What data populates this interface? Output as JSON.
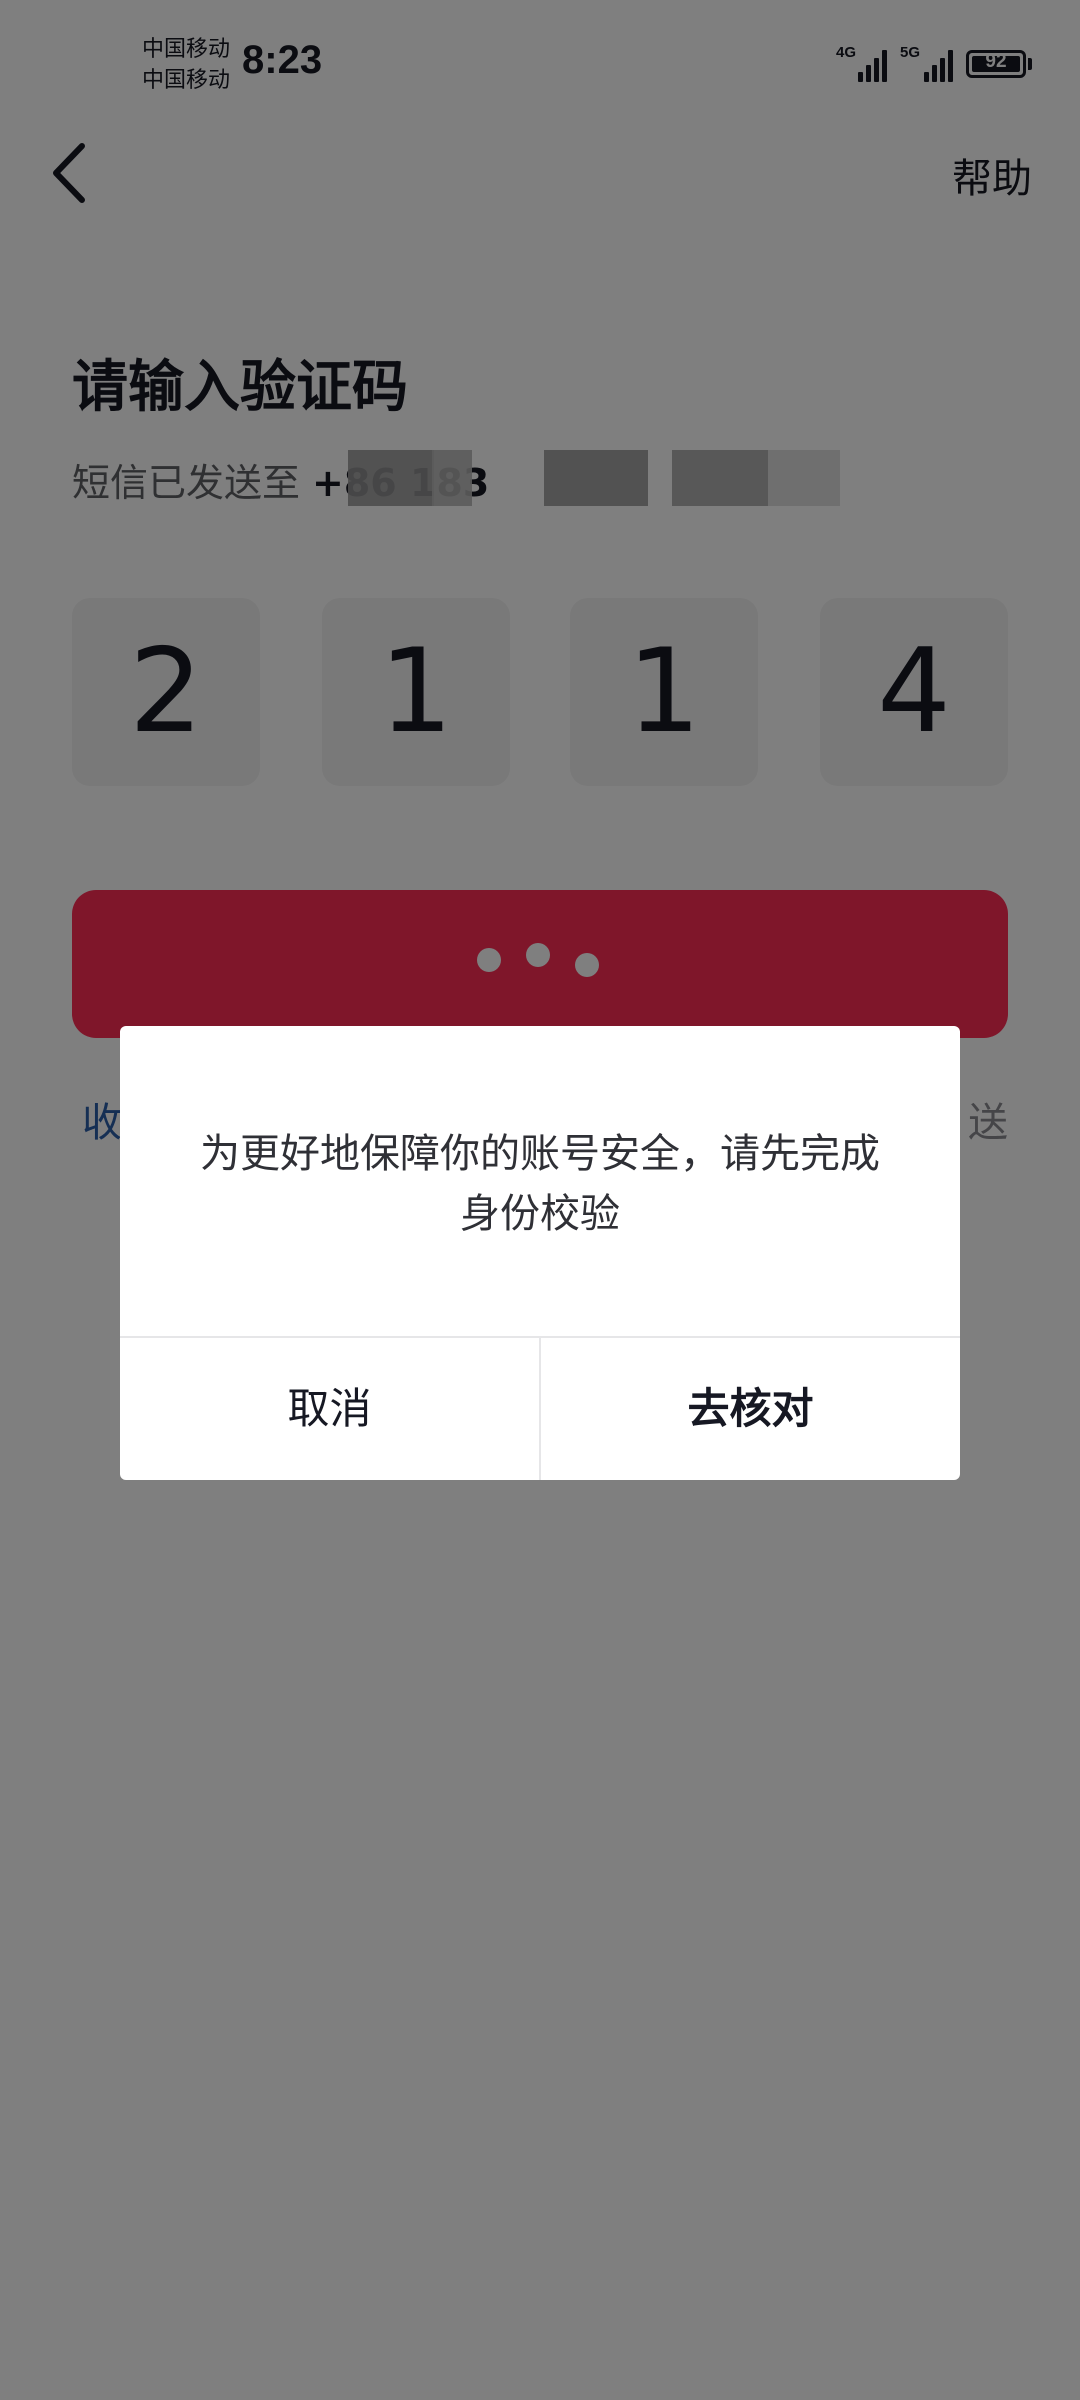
{
  "status_bar": {
    "carrier_1": "中国移动",
    "carrier_2": "中国移动",
    "time": "8:23",
    "network_1": "4G",
    "network_2": "5G",
    "battery": "92"
  },
  "header": {
    "back_icon": "chevron-left-icon",
    "help_label": "帮助"
  },
  "main": {
    "title": "请输入验证码",
    "sms_prefix": "短信已发送至",
    "phone_masked": "+86 183",
    "code_digits": [
      "2",
      "1",
      "1",
      "4"
    ],
    "submit_state": "loading",
    "below_left_label": "收",
    "below_right_label": "送"
  },
  "dialog": {
    "message": "为更好地保障你的账号安全，请先完成身份校验",
    "cancel_label": "取消",
    "confirm_label": "去核对"
  },
  "colors": {
    "accent": "#fe2c55",
    "overlay": "rgba(0,0,0,0.5)",
    "text_primary": "#161823",
    "link": "#2b5ea8"
  }
}
